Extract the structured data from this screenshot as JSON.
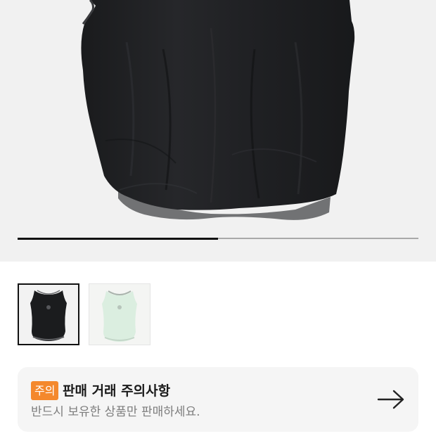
{
  "product_gallery": {
    "current_image": "black-mesh-sleeveless-top",
    "slide_progress": 0.5,
    "thumbnails": [
      {
        "name": "black-sleeveless-top",
        "color": "#1b1c1e",
        "selected": true
      },
      {
        "name": "mint-sleeveless-top",
        "color": "#dbeee0",
        "selected": false
      }
    ]
  },
  "notice": {
    "badge": "주의",
    "title": "판매 거래 주의사항",
    "subtitle": "반드시 보유한 상품만 판매하세요.",
    "arrow_icon": "arrow-right-icon"
  },
  "colors": {
    "badge": "#f4882c",
    "card_background": "#f5f5f5",
    "hero_background": "#f1f1f1"
  }
}
